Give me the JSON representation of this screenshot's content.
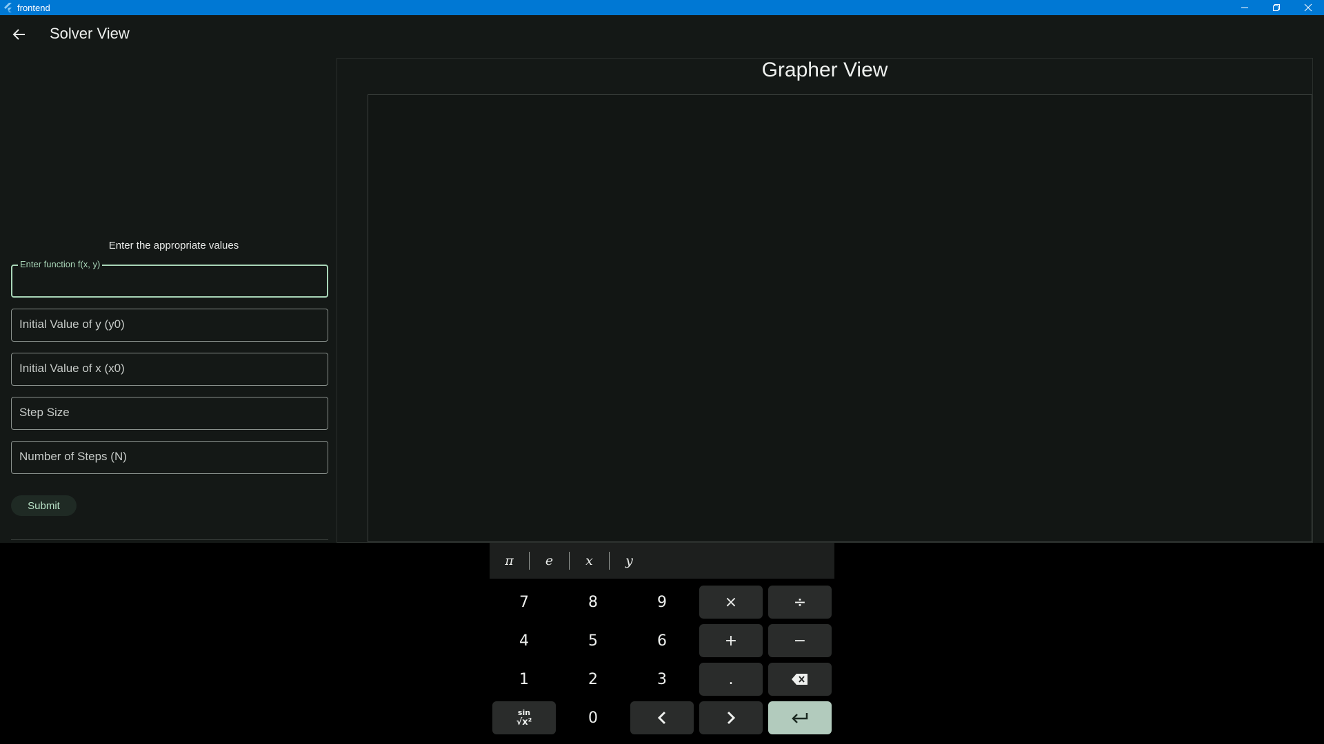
{
  "window": {
    "title": "frontend"
  },
  "appbar": {
    "title": "Solver View"
  },
  "form": {
    "instructions": "Enter the appropriate values",
    "function_label": "Enter function f(x, y)",
    "function_value": "",
    "y0_placeholder": "Initial Value of y (y0)",
    "x0_placeholder": "Initial Value of x (x0)",
    "step_placeholder": "Step Size",
    "n_placeholder": "Number of Steps (N)",
    "submit_label": "Submit"
  },
  "grapher": {
    "title": "Grapher View"
  },
  "keyboard": {
    "variables": [
      "π",
      "e",
      "x",
      "y"
    ],
    "rows": [
      [
        "7",
        "8",
        "9",
        "×",
        "÷"
      ],
      [
        "4",
        "5",
        "6",
        "+",
        "−"
      ],
      [
        "1",
        "2",
        "3",
        ".",
        "backspace-icon"
      ],
      [
        "functions-icon",
        "0",
        "chevron-left-icon",
        "chevron-right-icon",
        "enter-icon"
      ]
    ],
    "functions_key_top": "sin",
    "functions_key_bottom": "√x²"
  },
  "colors": {
    "titlebar": "#0078d4",
    "background": "#141816",
    "accent": "#a9d6b8",
    "enter_key": "#b2cbbd",
    "operator_key": "#2a2c2b"
  }
}
